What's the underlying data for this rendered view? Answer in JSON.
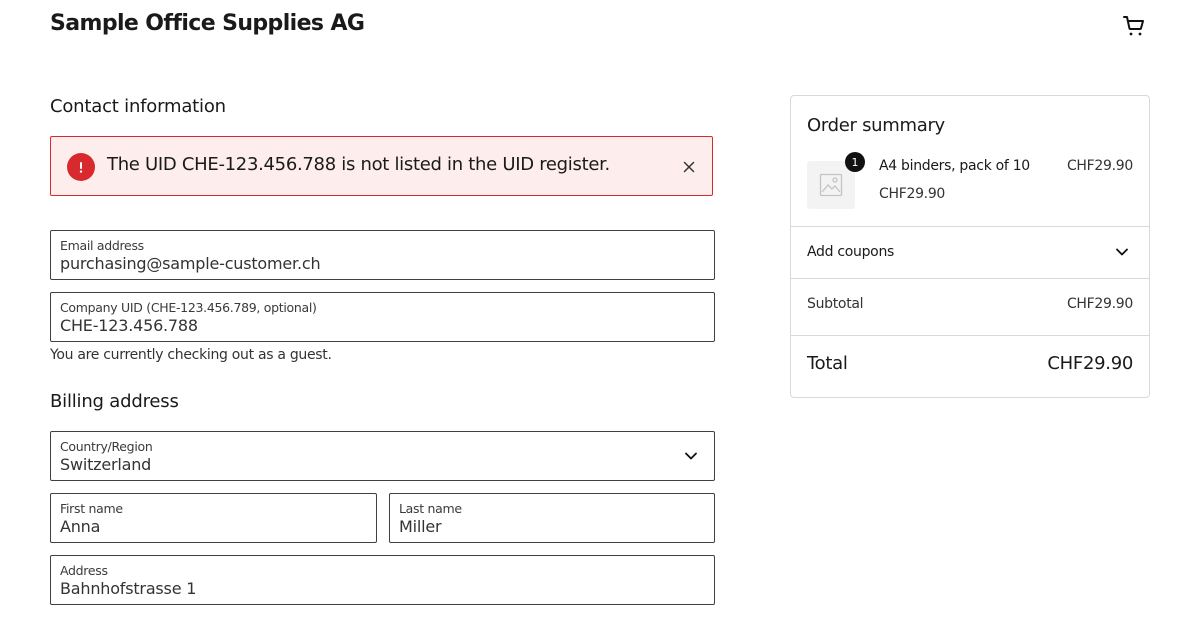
{
  "header": {
    "store_name": "Sample Office Supplies AG",
    "cart_icon": "shopping-cart-icon"
  },
  "contact": {
    "title": "Contact information",
    "error": {
      "icon": "error-alert-icon",
      "message": "The UID CHE-123.456.788 is not listed in the UID register.",
      "close_icon": "close-icon",
      "background": "#fdeeed",
      "accent": "#d8292f"
    },
    "email": {
      "label": "Email address",
      "value": "purchasing@sample-customer.ch"
    },
    "uid": {
      "label": "Company UID (CHE-123.456.789, optional)",
      "value": "CHE-123.456.788"
    },
    "guest_note": "You are currently checking out as a guest."
  },
  "billing": {
    "title": "Billing address",
    "country": {
      "label": "Country/Region",
      "value": "Switzerland",
      "icon": "chevron-down-icon"
    },
    "first_name": {
      "label": "First name",
      "value": "Anna"
    },
    "last_name": {
      "label": "Last name",
      "value": "Miller"
    },
    "address": {
      "label": "Address",
      "value": "Bahnhofstrasse 1"
    }
  },
  "summary": {
    "title": "Order summary",
    "item": {
      "name": "A4 binders, pack of 10",
      "unit_price": "CHF29.90",
      "line_price": "CHF29.90",
      "quantity": "1",
      "thumbnail_icon": "image-placeholder-icon"
    },
    "coupons": {
      "label": "Add coupons",
      "icon": "chevron-down-icon"
    },
    "subtotal": {
      "label": "Subtotal",
      "value": "CHF29.90"
    },
    "total": {
      "label": "Total",
      "value": "CHF29.90"
    }
  }
}
